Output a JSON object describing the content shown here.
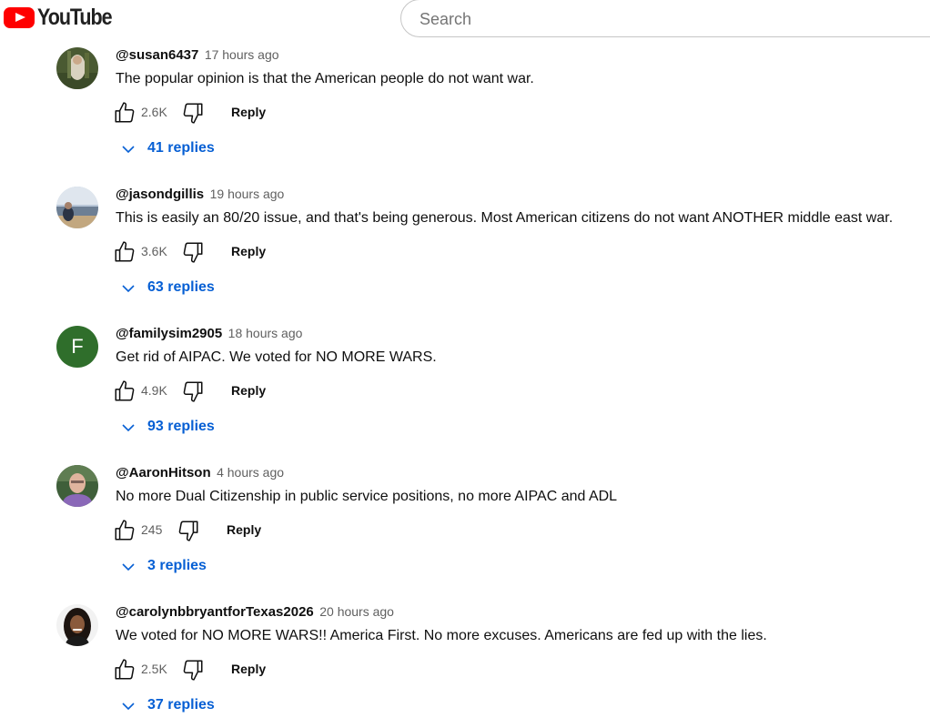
{
  "header": {
    "logo_text": "YouTube",
    "search_placeholder": "Search"
  },
  "comments": [
    {
      "author": "@susan6437",
      "time": "17 hours ago",
      "text": "The popular opinion is that the American people do not want war.",
      "likes": "2.6K",
      "reply_label": "Reply",
      "replies_label": "41 replies"
    },
    {
      "author": "@jasondgillis",
      "time": "19 hours ago",
      "text": "This is easily an 80/20 issue, and that's being generous. Most American citizens do not want ANOTHER middle east war.",
      "likes": "3.6K",
      "reply_label": "Reply",
      "replies_label": "63 replies"
    },
    {
      "author": "@familysim2905",
      "time": "18 hours ago",
      "text": "Get rid of AIPAC. We voted for NO MORE WARS.",
      "likes": "4.9K",
      "reply_label": "Reply",
      "replies_label": "93 replies",
      "avatar_letter": "F",
      "avatar_color": "#2f6e2b"
    },
    {
      "author": "@AaronHitson",
      "time": "4 hours ago",
      "text": "No more Dual Citizenship in public service positions, no more AIPAC and ADL",
      "likes": "245",
      "reply_label": "Reply",
      "replies_label": "3 replies"
    },
    {
      "author": "@carolynbbryantforTexas2026",
      "time": "20 hours ago",
      "text": "We voted for NO MORE WARS!! America First. No more excuses. Americans are fed up with the lies.",
      "likes": "2.5K",
      "reply_label": "Reply",
      "replies_label": "37 replies"
    }
  ],
  "colors": {
    "link_blue": "#065fd4",
    "brand_red": "#ff0000",
    "secondary_text": "#606060"
  },
  "icons": [
    "youtube-logo-icon",
    "thumbs-up-icon",
    "thumbs-down-icon",
    "chevron-down-icon"
  ]
}
